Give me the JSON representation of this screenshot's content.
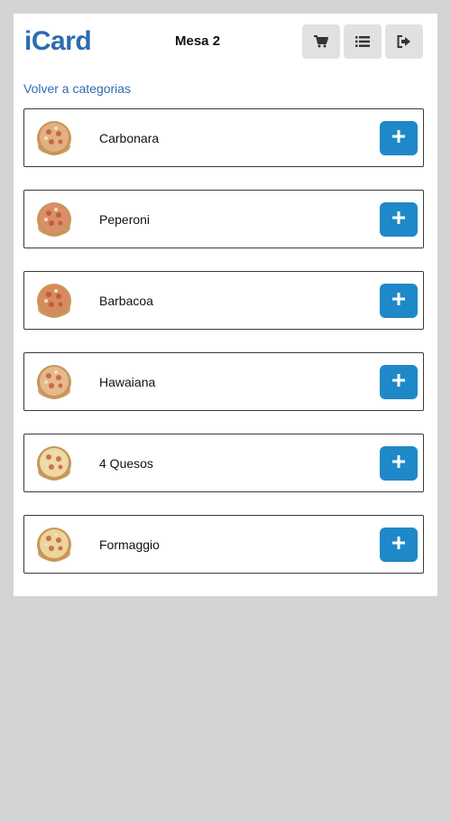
{
  "header": {
    "logo": "iCard",
    "table": "Mesa 2",
    "buttons": [
      {
        "icon": "cart-icon"
      },
      {
        "icon": "list-icon"
      },
      {
        "icon": "sign-out-icon"
      }
    ]
  },
  "back_link": "Volver a categorias",
  "products": [
    {
      "name": "Carbonara"
    },
    {
      "name": "Peperoni"
    },
    {
      "name": "Barbacoa"
    },
    {
      "name": "Hawaiana"
    },
    {
      "name": "4 Quesos"
    },
    {
      "name": "Formaggio"
    }
  ],
  "colors": {
    "brand": "#2c6cb0",
    "add_button": "#1f88c8",
    "background": "#d4d4d4"
  }
}
